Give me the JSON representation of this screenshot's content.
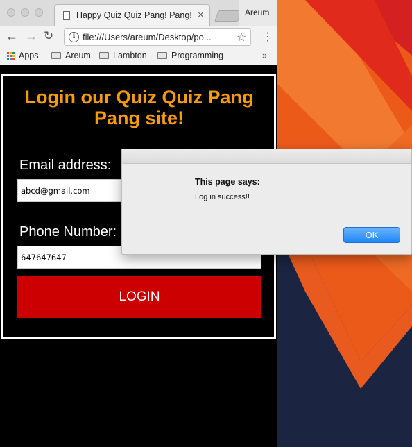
{
  "browser": {
    "tab_title": "Happy Quiz Quiz Pang! Pang!",
    "profile_name": "Areum",
    "url": "file:///Users/areum/Desktop/po...",
    "bookmarks": [
      {
        "label": "Apps",
        "icon": "apps-icon"
      },
      {
        "label": "Areum",
        "icon": "folder-icon"
      },
      {
        "label": "Lambton",
        "icon": "folder-icon"
      },
      {
        "label": "Programming",
        "icon": "folder-icon"
      }
    ],
    "more_bookmarks": "»"
  },
  "page": {
    "title": "Login our Quiz Quiz Pang Pang site!",
    "email_label": "Email address:",
    "email_value": "abcd@gmail.com",
    "phone_label": "Phone Number:",
    "phone_value": "647647647",
    "login_button": "LOGIN",
    "colors": {
      "title": "#f79c08",
      "button": "#cc0000",
      "background": "#000000"
    }
  },
  "dialog": {
    "heading": "This page says:",
    "message": "Log in success!!",
    "ok_label": "OK",
    "ok_color": "#1d88f7"
  }
}
